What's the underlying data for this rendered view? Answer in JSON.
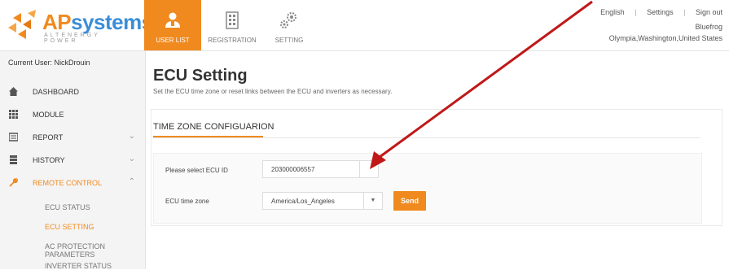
{
  "brand": {
    "name_prefix": "AP",
    "name_suffix": "systems",
    "tagline": "ALTENERGY POWER"
  },
  "nav": [
    {
      "label": "USER LIST",
      "icon": "user-icon",
      "active": true
    },
    {
      "label": "REGISTRATION",
      "icon": "building-icon",
      "active": false
    },
    {
      "label": "SETTING",
      "icon": "gears-icon",
      "active": false
    }
  ],
  "top_links": {
    "language": "English",
    "settings": "Settings",
    "signout": "Sign out",
    "separator": "|"
  },
  "user_info": {
    "name": "Bluefrog",
    "location": "Olympia,Washington,United States"
  },
  "sidebar": {
    "current_user": "Current User: NickDrouin",
    "items": [
      {
        "label": "DASHBOARD",
        "icon": "home-icon",
        "chevron": ""
      },
      {
        "label": "MODULE",
        "icon": "grid-icon",
        "chevron": ""
      },
      {
        "label": "REPORT",
        "icon": "report-icon",
        "chevron": "⌄"
      },
      {
        "label": "HISTORY",
        "icon": "database-icon",
        "chevron": "⌄"
      },
      {
        "label": "REMOTE CONTROL",
        "icon": "wrench-icon",
        "chevron": "⌃"
      }
    ],
    "sub_items": [
      {
        "label": "ECU STATUS",
        "active": false
      },
      {
        "label": "ECU SETTING",
        "active": true
      },
      {
        "label": "AC PROTECTION PARAMETERS",
        "active": false
      },
      {
        "label": "INVERTER STATUS",
        "active": false
      }
    ]
  },
  "main": {
    "title": "ECU Setting",
    "subtitle": "Set the ECU time zone or reset links between the ECU and inverters as necessary.",
    "panel_title": "TIME ZONE CONFIGUARION",
    "form": {
      "ecu_label": "Please select ECU ID",
      "ecu_value": "203000006557",
      "tz_label": "ECU time zone",
      "tz_value": "America/Los_Angeles",
      "send_label": "Send"
    }
  },
  "colors": {
    "accent": "#f08a1f",
    "brand_blue": "#3a8ed8",
    "annotation": "#c01818"
  }
}
